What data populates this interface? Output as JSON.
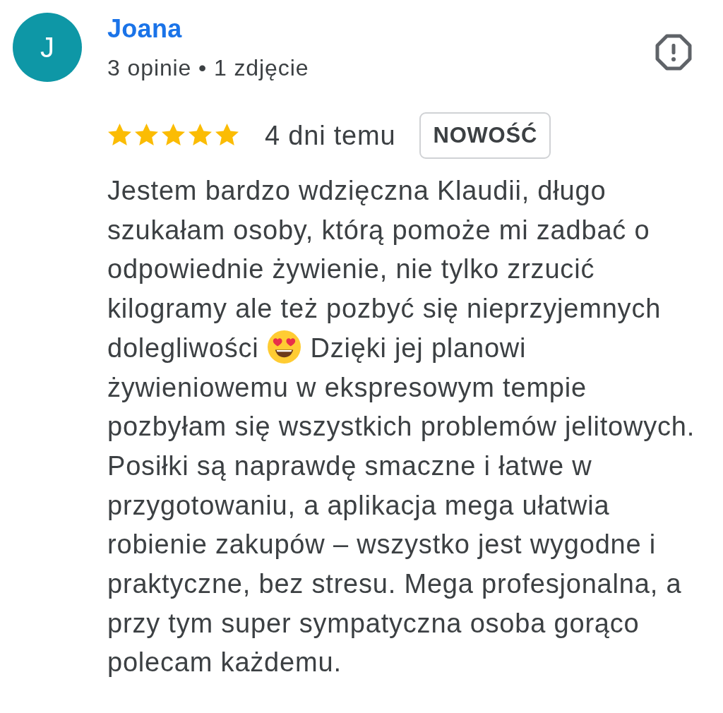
{
  "reviewer": {
    "initial": "J",
    "name": "Joana",
    "stats": "3 opinie • 1 zdjęcie"
  },
  "review": {
    "stars": 5,
    "time": "4 dni temu",
    "badge": "NOWOŚĆ",
    "body": [
      {
        "kind": "text",
        "text": "Jestem bardzo wdzięczna Klaudii, długo szukałam osoby, którą pomoże mi zadbać o odpowiednie żywienie, nie tylko zrzucić kilogramy ale też pozbyć się nieprzyjemnych dolegliwości"
      },
      {
        "kind": "emoji"
      },
      {
        "kind": "text",
        "text": "Dzięki jej planowi żywieniowemu w ekspresowym tempie pozbyłam się wszystkich problemów jelitowych. Posiłki są naprawdę smaczne i łatwe w przygotowaniu, a aplikacja mega ułatwia robienie zakupów – wszystko jest wygodne i praktyczne, bez stresu. Mega profesjonalna, a przy tym super sympatyczna osoba gorąco polecam każdemu."
      }
    ]
  }
}
